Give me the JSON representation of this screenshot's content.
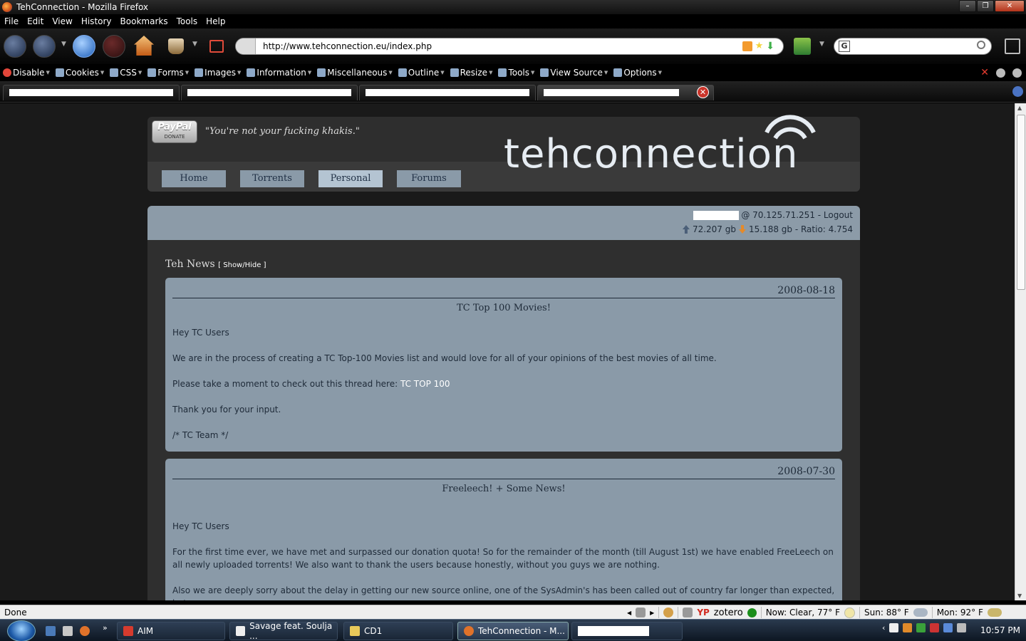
{
  "window": {
    "title": "TehConnection - Mozilla Firefox"
  },
  "menubar": [
    "File",
    "Edit",
    "View",
    "History",
    "Bookmarks",
    "Tools",
    "Help"
  ],
  "address": {
    "url": "http://www.tehconnection.eu/index.php"
  },
  "devtoolbar": [
    "Disable",
    "Cookies",
    "CSS",
    "Forms",
    "Images",
    "Information",
    "Miscellaneous",
    "Outline",
    "Resize",
    "Tools",
    "View Source",
    "Options"
  ],
  "site": {
    "quote": "\"You're not your fucking khakis.\"",
    "paypal": {
      "top": "PayPal",
      "bottom": "DONATE"
    },
    "logo": "tehconnection",
    "nav": [
      "Home",
      "Torrents",
      "Personal",
      "Forums"
    ],
    "user": {
      "ip": "@ 70.125.71.251 - Logout",
      "uploaded": "72.207 gb",
      "downloaded": "15.188 gb - Ratio: 4.754"
    },
    "news_heading": "Teh News",
    "news_toggle": "[ Show/Hide ]",
    "news": [
      {
        "date": "2008-08-18",
        "title": "TC Top 100 Movies!",
        "p1": "Hey TC Users",
        "p2_pre": "We are in the process of creating a ",
        "p2_bold": "TC Top-100 Movies",
        "p2_post": " list and would love for all of your opinions of the best movies of all time.",
        "p3_pre": "Please take a moment to check out this thread here: ",
        "p3_link": "TC TOP 100",
        "p4": "Thank you for your input.",
        "p5": "/* TC Team */"
      },
      {
        "date": "2008-07-30",
        "title": "Freeleech! + Some News!",
        "p1": "Hey TC Users",
        "p2": "For the first time ever, we have met and surpassed our donation quota! So for the remainder of the month (till August 1st) we have enabled FreeLeech on all newly uploaded torrents! We also want to thank the users because honestly, without you guys we are nothing.",
        "p3": "Also we are deeply sorry about the delay in getting our new source online, one of the SysAdmin's has been called out of country far longer than expected, but"
      }
    ]
  },
  "status": {
    "text": "Done",
    "yp": "YP",
    "zotero": "zotero",
    "weather_now": "Now: Clear, 77° F",
    "weather_sun": "Sun: 88° F",
    "weather_mon": "Mon: 92° F"
  },
  "taskbar": {
    "buttons": [
      "AIM",
      "Savage feat. Soulja ...",
      "CD1",
      "TehConnection - M..."
    ],
    "clock": "10:57 PM"
  }
}
